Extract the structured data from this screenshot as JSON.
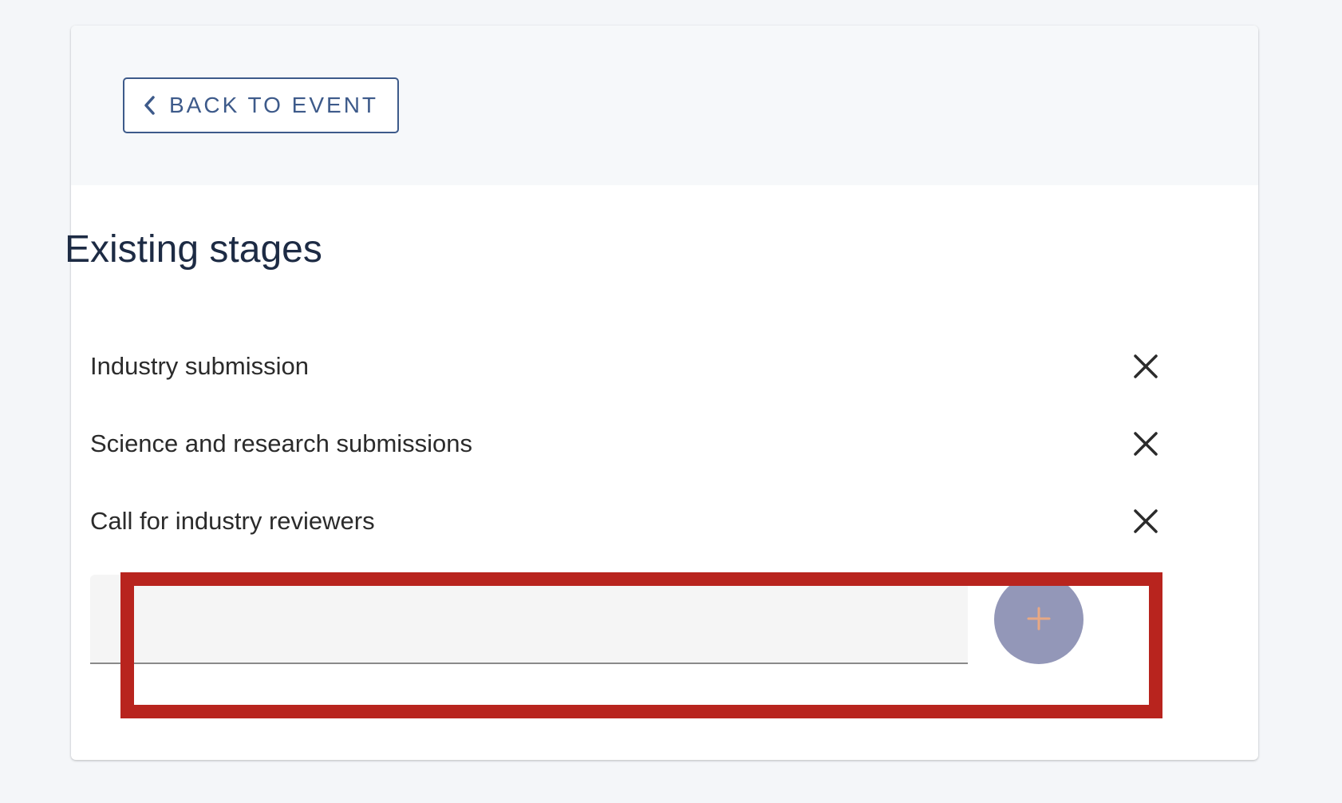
{
  "header": {
    "back_label": "BACK TO EVENT",
    "back_icon": "chevron-left-icon"
  },
  "stages": {
    "title": "Existing stages",
    "items": [
      {
        "label": "Industry submission",
        "remove_icon": "close-icon"
      },
      {
        "label": "Science and research submissions",
        "remove_icon": "close-icon"
      },
      {
        "label": "Call for industry reviewers",
        "remove_icon": "close-icon"
      }
    ],
    "new_stage": {
      "value": "",
      "add_icon": "plus-icon"
    }
  },
  "colors": {
    "accent": "#3d5a8a",
    "title": "#1d2b44",
    "add_button": "#9397b8",
    "add_icon": "#e8a884",
    "highlight": "#b8241e",
    "page_background": "#f4f6f9"
  }
}
